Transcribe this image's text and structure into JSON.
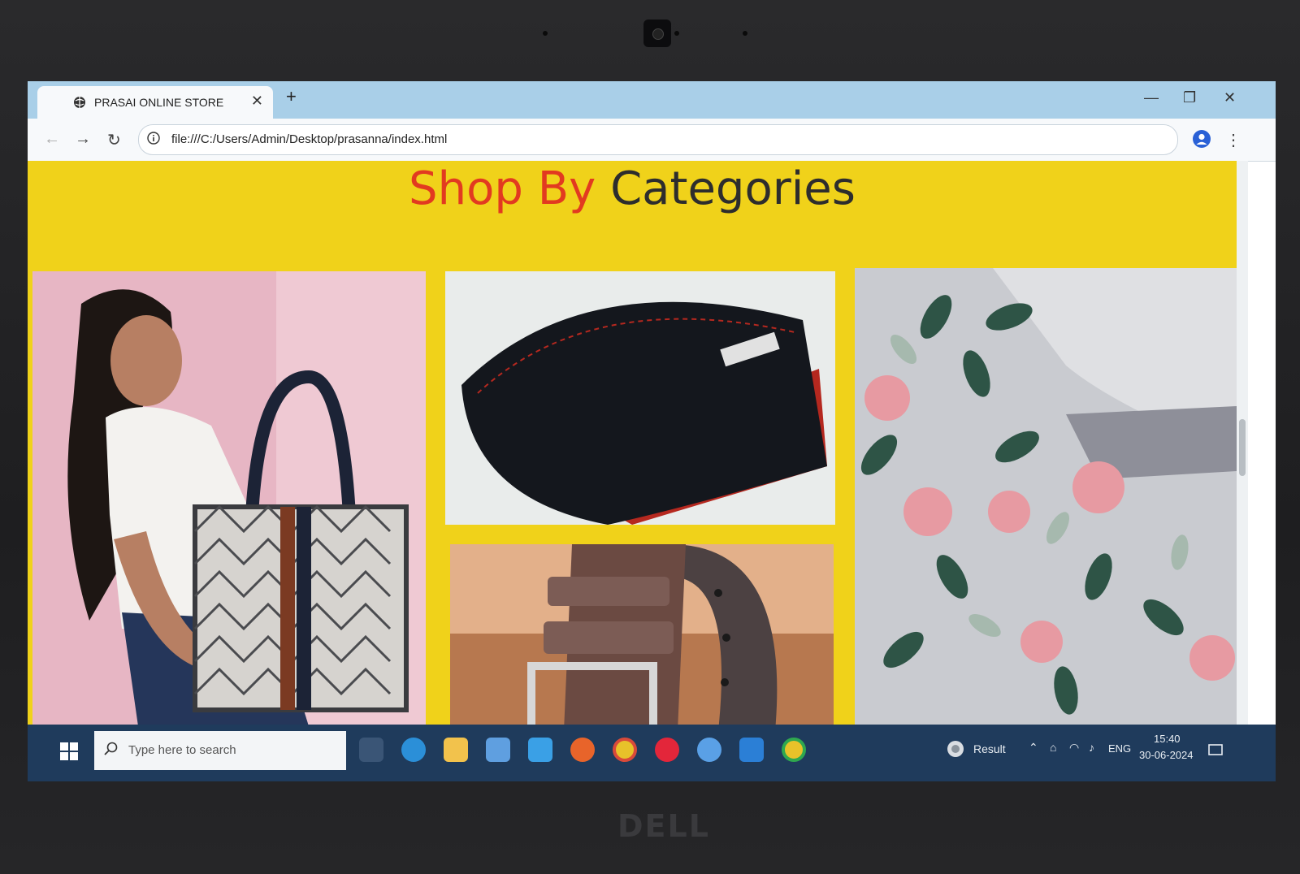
{
  "browser": {
    "tab_title": "PRASAI ONLINE STORE",
    "tab_close": "✕",
    "new_tab": "+",
    "url": "file:///C:/Users/Admin/Desktop/prasanna/index.html",
    "window_controls": {
      "minimize": "—",
      "restore": "❐",
      "close": "✕"
    },
    "back": "←",
    "forward": "→",
    "reload": "↻",
    "menu": "⋮"
  },
  "page": {
    "heading_accent": "Shop By",
    "heading_rest": "Categories",
    "colors": {
      "background": "#f0d21a",
      "accent": "#e23a20",
      "text": "#2d2d2d"
    },
    "tiles": [
      {
        "name": "handbag",
        "icon": "handbag-photo"
      },
      {
        "name": "wallet",
        "icon": "wallet-photo"
      },
      {
        "name": "belt",
        "icon": "belt-photo"
      },
      {
        "name": "floral-fabric",
        "icon": "floral-fabric-photo"
      }
    ]
  },
  "taskbar": {
    "search_placeholder": "Type here to search",
    "weather_label": "Result",
    "language": "ENG",
    "time": "15:40",
    "date": "30-06-2024"
  },
  "device": {
    "brand": "DELL"
  }
}
